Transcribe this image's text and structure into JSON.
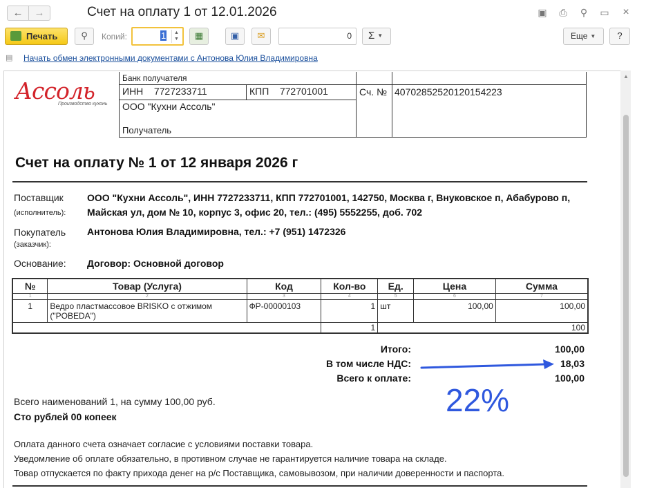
{
  "window": {
    "title": "Счет на оплату 1 от 12.01.2026",
    "icons": [
      "save-icon",
      "print-icon",
      "preview-icon",
      "restore-icon",
      "close-icon"
    ]
  },
  "toolbar": {
    "print_label": "Печать",
    "copies_label": "Копий:",
    "copies_value": "1",
    "sum_value": "0",
    "sigma_label": "Σ",
    "more_label": "Еще",
    "help_label": "?"
  },
  "exchange": {
    "link_text": "Начать обмен электронными документами с Антонова Юлия Владимировна"
  },
  "logo": {
    "brand": "Ассоль",
    "tagline": "Производство кухонь"
  },
  "bank": {
    "bank_label": "Банк получателя",
    "inn": "ИНН    7727233711",
    "kpp": "КПП    772701001",
    "account_label": "Сч. №",
    "account_number": "40702852520120154223",
    "recipient_name": "ООО \"Кухни Ассоль\"",
    "recipient_label": "Получатель"
  },
  "document": {
    "title": "Счет на оплату № 1 от 12 января 2026 г"
  },
  "supplier": {
    "label": "Поставщик",
    "sublabel": "(исполнитель):",
    "text": "ООО \"Кухни Ассоль\",  ИНН 7727233711,  КПП 772701001,  142750, Москва г, Внуковское п, Абабурово п, Майская ул, дом № 10, корпус 3, офис 20,  тел.: (495) 5552255, доб. 702"
  },
  "buyer": {
    "label": "Покупатель",
    "sublabel": "(заказчик):",
    "text": "Антонова Юлия Владимировна,  тел.: +7 (951) 1472326"
  },
  "basis": {
    "label": "Основание:",
    "text": "Договор: Основной договор"
  },
  "table": {
    "headers": [
      "№",
      "Товар (Услуга)",
      "Код",
      "Кол-во",
      "Ед.",
      "Цена",
      "Сумма"
    ],
    "col_numbers": [
      "1",
      "2",
      "3",
      "4",
      "5",
      "6",
      "7"
    ],
    "rows": [
      {
        "n": "1",
        "name": "Ведро пластмассовое BRISKO с отжимом (\"POBEDA\")",
        "code": "ФР-00000103",
        "qty": "1",
        "unit": "шт",
        "price": "100,00",
        "sum": "100,00"
      }
    ],
    "total_qty": "1",
    "total_sum": "100"
  },
  "totals": {
    "itogo_label": "Итого:",
    "itogo_value": "100,00",
    "nds_label": "В том числе НДС:",
    "nds_value": "18,03",
    "total_label": "Всего к оплате:",
    "total_value": "100,00"
  },
  "annotation": {
    "percent": "22%",
    "arrow_color": "#2f58de"
  },
  "summary": {
    "line1": "Всего наименований 1, на сумму 100,00 руб.",
    "line2": "Сто рублей 00 копеек"
  },
  "notes": [
    "Оплата данного счета означает согласие с условиями поставки товара.",
    "Уведомление об оплате обязательно, в противном случае не гарантируется наличие товара на складе.",
    "Товар отпускается по факту прихода денег на р/с Поставщика, самовывозом, при наличии доверенности и паспорта."
  ]
}
